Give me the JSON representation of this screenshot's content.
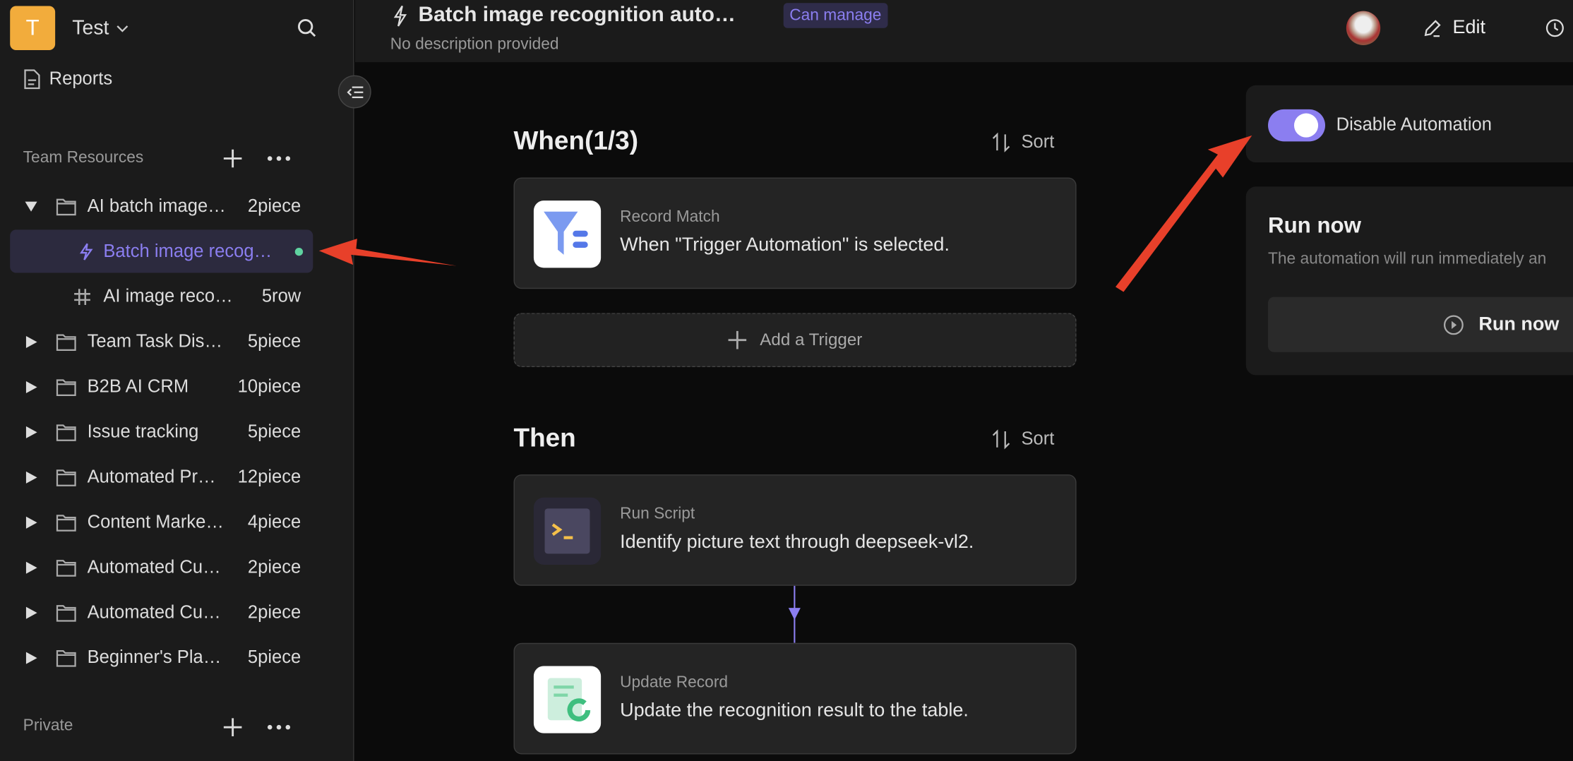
{
  "workspace": {
    "initial": "T",
    "name": "Test"
  },
  "sidebar": {
    "reports_label": "Reports",
    "team_section": "Team Resources",
    "private_section": "Private",
    "items": [
      {
        "label": "AI batch image…",
        "count": "2piece",
        "type": "folder",
        "expanded": true
      },
      {
        "label": "Batch image recog…",
        "count": "",
        "type": "automation",
        "selected": true,
        "status_dot": "#5fd3a0"
      },
      {
        "label": "AI image reco…",
        "count": "5row",
        "type": "table"
      },
      {
        "label": "Team Task Dis…",
        "count": "5piece",
        "type": "folder"
      },
      {
        "label": "B2B AI CRM",
        "count": "10piece",
        "type": "folder"
      },
      {
        "label": "Issue tracking",
        "count": "5piece",
        "type": "folder"
      },
      {
        "label": "Automated Pr…",
        "count": "12piece",
        "type": "folder"
      },
      {
        "label": "Content Marke…",
        "count": "4piece",
        "type": "folder"
      },
      {
        "label": "Automated Cu…",
        "count": "2piece",
        "type": "folder"
      },
      {
        "label": "Automated Cu…",
        "count": "2piece",
        "type": "folder"
      },
      {
        "label": "Beginner's Pla…",
        "count": "5piece",
        "type": "folder"
      }
    ]
  },
  "header": {
    "title": "Batch image recognition auto…",
    "badge": "Can manage",
    "description": "No description provided",
    "edit_label": "Edit"
  },
  "when": {
    "title": "When(1/3)",
    "sort_label": "Sort",
    "trigger": {
      "kind": "Record Match",
      "desc": "When \"Trigger Automation\" is selected."
    },
    "add_label": "Add a Trigger"
  },
  "then": {
    "title": "Then",
    "sort_label": "Sort",
    "actions": [
      {
        "kind": "Run Script",
        "desc": "Identify picture text through deepseek-vl2."
      },
      {
        "kind": "Update Record",
        "desc": "Update the recognition result to the table."
      }
    ]
  },
  "right": {
    "toggle_label": "Disable Automation",
    "toggle_on": true,
    "run_title": "Run now",
    "run_desc": "The automation will run immediately an",
    "run_button": "Run now"
  },
  "colors": {
    "accent": "#8b7ef0",
    "logo": "#f2ac3c",
    "annotation": "#e8402a"
  }
}
